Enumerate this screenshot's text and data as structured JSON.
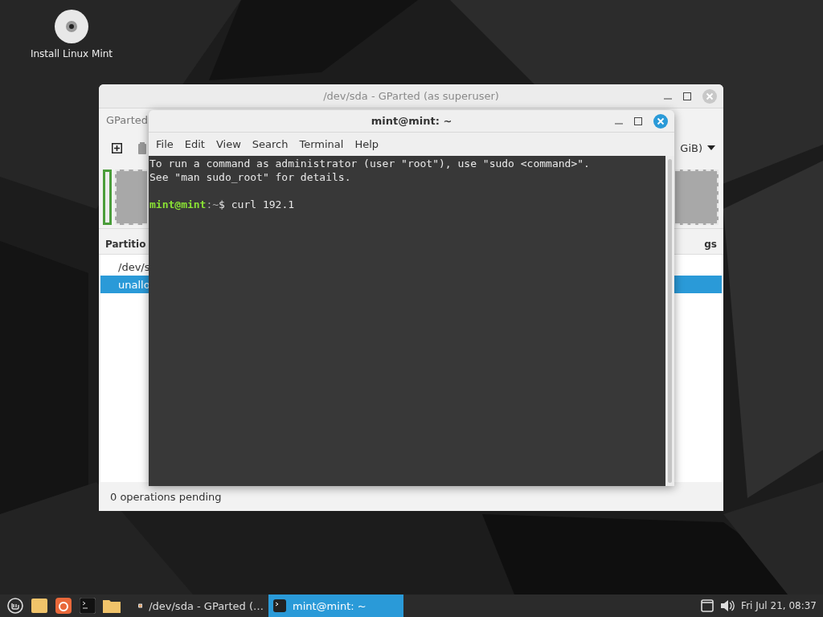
{
  "desktop": {
    "icons": [
      {
        "label": "Install Linux Mint"
      }
    ]
  },
  "gparted": {
    "title": "/dev/sda - GParted (as superuser)",
    "menu": [
      "GParted"
    ],
    "device": "GiB)",
    "columns": [
      "Partitio",
      "gs"
    ],
    "rows": [
      {
        "cell": "/dev/s",
        "selected": false
      },
      {
        "cell": "unallo",
        "selected": true
      }
    ],
    "status": "0 operations pending"
  },
  "terminal": {
    "title": "mint@mint: ~",
    "menu": [
      "File",
      "Edit",
      "View",
      "Search",
      "Terminal",
      "Help"
    ],
    "output": [
      "To run a command as administrator (user \"root\"), use \"sudo <command>\".",
      "See \"man sudo_root\" for details."
    ],
    "prompt": {
      "user": "mint@mint",
      "path": ":~",
      "command": "$ curl 192.1"
    }
  },
  "taskbar": {
    "windows": [
      {
        "kind": "gparted",
        "label": "/dev/sda - GParted (…",
        "selected": false
      },
      {
        "kind": "terminal",
        "label": "mint@mint: ~",
        "selected": true
      }
    ],
    "clock": "Fri Jul 21, 08:37"
  }
}
